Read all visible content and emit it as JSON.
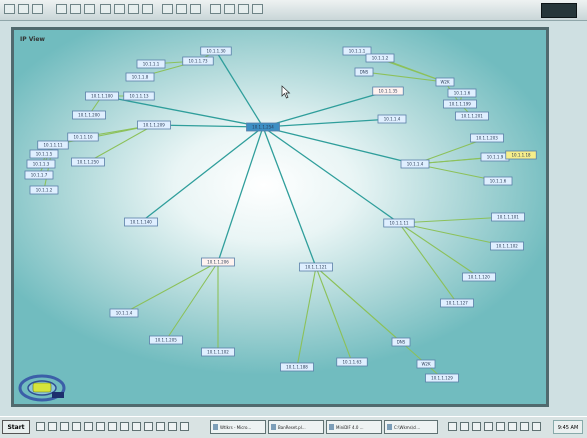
{
  "window": {
    "title": "IP View"
  },
  "taskbar": {
    "start_label": "Start",
    "clock": "9:45 AM",
    "tasks": [
      {
        "label": "Wtlkrs - Micro..."
      },
      {
        "label": "BanReset.pl..."
      },
      {
        "label": "MiniDIF 4.0 ..."
      },
      {
        "label": "C:\\Wkms\\cl..."
      }
    ]
  },
  "topology": {
    "root": {
      "label": "10.1.1.254"
    },
    "nodes": [
      {
        "label": "10.1.1.30"
      },
      {
        "label": "10.1.1.1"
      },
      {
        "label": "10.1.1.73"
      },
      {
        "label": "10.1.1.8"
      },
      {
        "label": "10.1.1.100"
      },
      {
        "label": "10.1.1.13"
      },
      {
        "label": "10.1.1.200"
      },
      {
        "label": "10.1.1.209"
      },
      {
        "label": "10.1.1.10"
      },
      {
        "label": "10.1.1.11"
      },
      {
        "label": "10.1.1.5"
      },
      {
        "label": "10.1.1.3"
      },
      {
        "label": "10.1.1.250"
      },
      {
        "label": "10.1.1.7"
      },
      {
        "label": "10.1.1.2"
      },
      {
        "label": "10.1.1.140"
      },
      {
        "label": "10.1.1.1"
      },
      {
        "label": "10.1.1.2"
      },
      {
        "label": "DNS"
      },
      {
        "label": "10.1.1.35"
      },
      {
        "label": "W2K"
      },
      {
        "label": "10.1.1.6"
      },
      {
        "label": "10.1.1.199"
      },
      {
        "label": "10.1.1.4"
      },
      {
        "label": "10.1.1.201"
      },
      {
        "label": "10.1.1.203"
      },
      {
        "label": "10.1.1.9"
      },
      {
        "label": "10.1.1.18"
      },
      {
        "label": "10.1.1.4"
      },
      {
        "label": "10.1.1.6"
      },
      {
        "label": "10.1.1.11"
      },
      {
        "label": "10.1.1.101"
      },
      {
        "label": "10.1.1.102"
      },
      {
        "label": "10.1.1.120"
      },
      {
        "label": "10.1.1.127"
      },
      {
        "label": "10.1.1.121"
      },
      {
        "label": "10.1.1.188"
      },
      {
        "label": "10.1.1.63"
      },
      {
        "label": "DNS"
      },
      {
        "label": "W2K"
      },
      {
        "label": "10.1.1.129"
      },
      {
        "label": "10.1.1.206"
      },
      {
        "label": "10.1.1.4"
      },
      {
        "label": "10.1.1.205"
      },
      {
        "label": "10.1.1.102"
      }
    ]
  }
}
